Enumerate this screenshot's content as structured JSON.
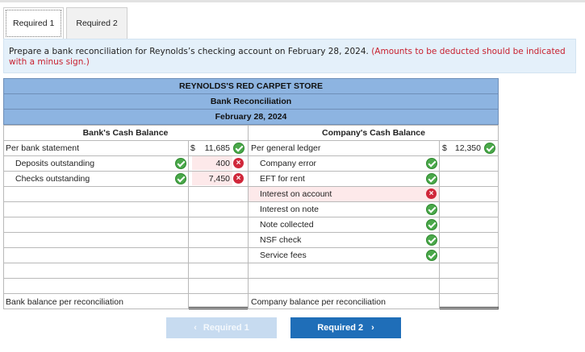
{
  "tabs": [
    {
      "label": "Required 1",
      "active": true
    },
    {
      "label": "Required 2",
      "active": false
    }
  ],
  "instructions": {
    "text": "Prepare a bank reconciliation for Reynolds’s checking account on February 28, 2024. ",
    "note": "(Amounts to be deducted should be indicated with a minus sign.)"
  },
  "table": {
    "company": "REYNOLDS'S RED CARPET STORE",
    "statement": "Bank Reconciliation",
    "date": "February 28, 2024",
    "bank_heading": "Bank's Cash Balance",
    "company_heading": "Company's Cash Balance",
    "bank": {
      "start_label": "Per bank statement",
      "currency": "$",
      "start_value": "11,685",
      "rows": [
        {
          "label": "Deposits outstanding",
          "amount": "400",
          "label_status": "correct",
          "amount_status": "incorrect"
        },
        {
          "label": "Checks outstanding",
          "amount": "7,450",
          "label_status": "correct",
          "amount_status": "incorrect"
        }
      ],
      "end_label": "Bank balance per reconciliation",
      "end_value": ""
    },
    "book": {
      "start_label": "Per general ledger",
      "currency": "$",
      "start_value": "12,350",
      "rows": [
        {
          "label": "Company error",
          "status": "correct"
        },
        {
          "label": "EFT for rent",
          "status": "correct"
        },
        {
          "label": "Interest on account",
          "status": "incorrect"
        },
        {
          "label": "Interest on note",
          "status": "correct"
        },
        {
          "label": "Note collected",
          "status": "correct"
        },
        {
          "label": "NSF check",
          "status": "correct"
        },
        {
          "label": "Service fees",
          "status": "correct"
        }
      ],
      "end_label": "Company balance per reconciliation",
      "end_value": ""
    }
  },
  "nav": {
    "prev_label": "Required 1",
    "next_label": "Required 2",
    "prev_icon": "chevron-left-icon",
    "next_icon": "chevron-right-icon"
  },
  "colors": {
    "header_blue": "#8db4e1",
    "correct_green": "#4aa84a",
    "incorrect_red": "#d0273a",
    "note_red": "#c8202f",
    "next_button": "#1f6eb8"
  }
}
